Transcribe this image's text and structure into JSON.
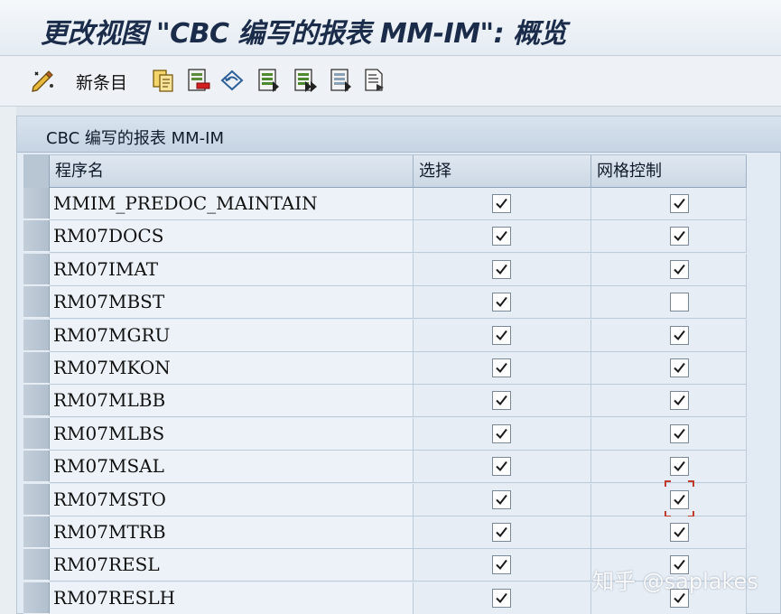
{
  "window": {
    "title": "更改视图 \"CBC 编写的报表 MM-IM\": 概览"
  },
  "toolbar": {
    "new_entries_label": "新条目",
    "icons": [
      "change-display-icon",
      "copy-icon",
      "delete-icon",
      "undo-icon",
      "select-all-icon",
      "select-block-icon",
      "deselect-all-icon",
      "details-icon"
    ]
  },
  "panel": {
    "title": "CBC 编写的报表 MM-IM"
  },
  "table": {
    "columns": [
      "程序名",
      "选择",
      "网格控制"
    ],
    "rows": [
      {
        "program": "MMIM_PREDOC_MAINTAIN",
        "select": true,
        "grid": true
      },
      {
        "program": "RM07DOCS",
        "select": true,
        "grid": true
      },
      {
        "program": "RM07IMAT",
        "select": true,
        "grid": true
      },
      {
        "program": "RM07MBST",
        "select": true,
        "grid": false
      },
      {
        "program": "RM07MGRU",
        "select": true,
        "grid": true
      },
      {
        "program": "RM07MKON",
        "select": true,
        "grid": true
      },
      {
        "program": "RM07MLBB",
        "select": true,
        "grid": true
      },
      {
        "program": "RM07MLBS",
        "select": true,
        "grid": true
      },
      {
        "program": "RM07MSAL",
        "select": true,
        "grid": true
      },
      {
        "program": "RM07MSTO",
        "select": true,
        "grid": true,
        "focused": true
      },
      {
        "program": "RM07MTRB",
        "select": true,
        "grid": true
      },
      {
        "program": "RM07RESL",
        "select": true,
        "grid": true
      },
      {
        "program": "RM07RESLH",
        "select": true,
        "grid": true
      }
    ]
  },
  "watermark": "知乎 @saplakes",
  "colors": {
    "title": "#1b2c4a",
    "focus": "#c0392b"
  }
}
